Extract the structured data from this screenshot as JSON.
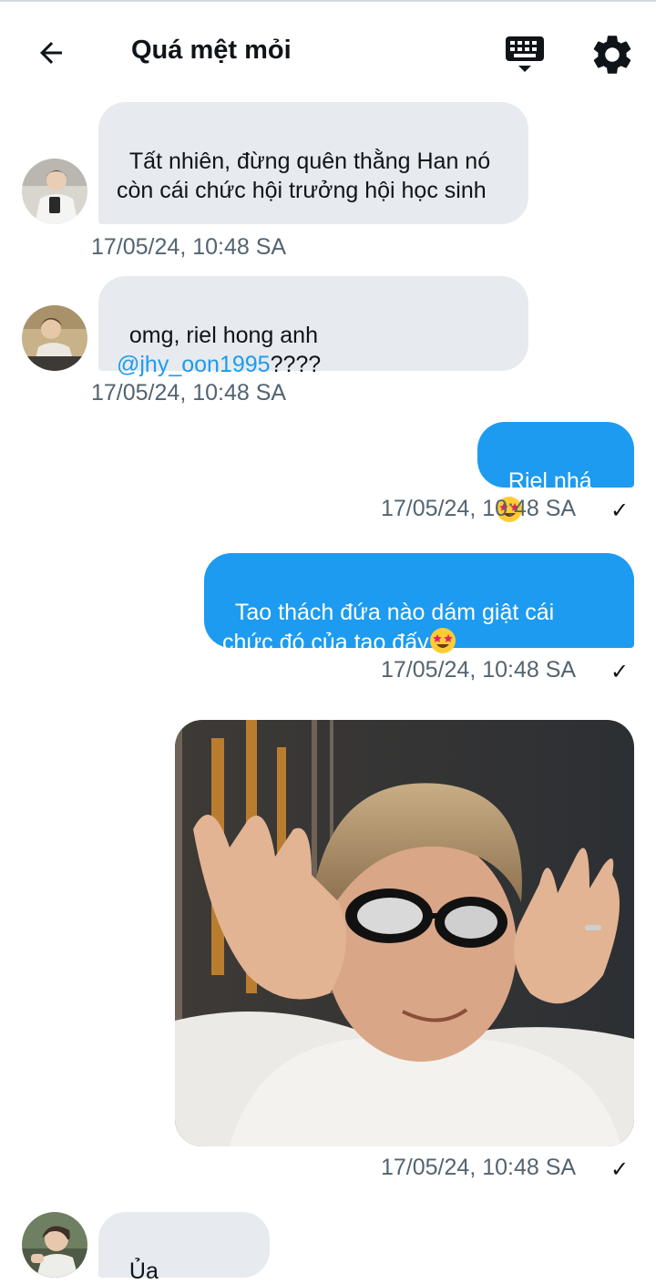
{
  "header": {
    "title": "Quá mệt mỏi",
    "back_icon": "arrow-left-icon",
    "keyboard_icon": "keyboard-icon",
    "settings_icon": "gear-icon"
  },
  "colors": {
    "outgoing_bubble": "#1d9bf0",
    "incoming_bubble": "#e7eaee",
    "timestamp": "#536471",
    "mention": "#1d9bf0"
  },
  "messages": [
    {
      "direction": "incoming",
      "text": "Tất nhiên, đừng quên thằng Han nó còn cái chức hội trưởng hội học sinh",
      "timestamp": "17/05/24, 10:48 SA"
    },
    {
      "direction": "incoming",
      "text_before": "omg, riel hong anh",
      "mention": "@jhy_oon1995",
      "text_after": "????",
      "timestamp": "17/05/24, 10:48 SA"
    },
    {
      "direction": "outgoing",
      "text": "Riel nhá",
      "emoji": "star-struck-emoji",
      "timestamp": "17/05/24, 10:48 SA",
      "status": "✓"
    },
    {
      "direction": "outgoing",
      "text_line1": "Tao thách đứa nào dám giật cái",
      "text_line2": "chức đó của tao đấy",
      "emoji": "star-struck-emoji",
      "timestamp": "17/05/24, 10:48 SA",
      "status": "✓"
    },
    {
      "direction": "outgoing",
      "media": "photo",
      "timestamp": "17/05/24, 10:48 SA",
      "status": "✓"
    },
    {
      "direction": "incoming",
      "text": "Ủa bạn????"
    }
  ]
}
